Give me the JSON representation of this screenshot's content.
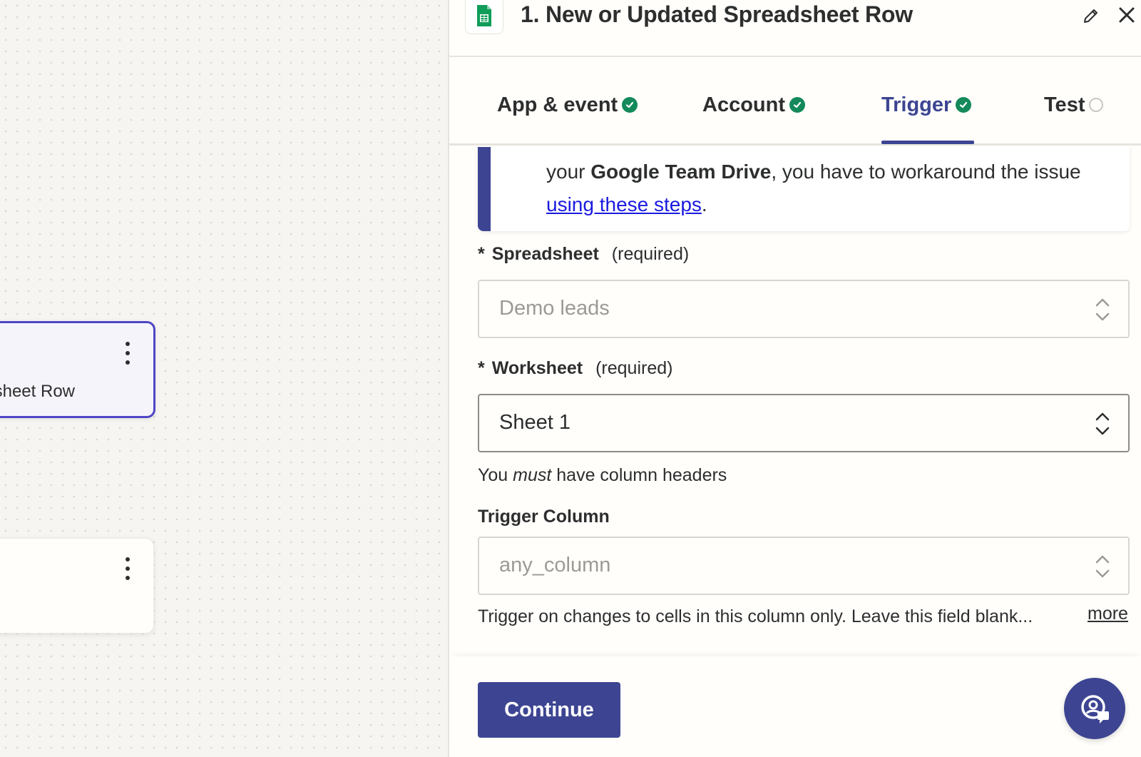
{
  "canvas": {
    "selected_node_label": "New or Updated Spreadsheet Row"
  },
  "panel": {
    "title": "1. New or Updated Spreadsheet Row",
    "tabs": [
      {
        "label": "App & event",
        "status": "complete"
      },
      {
        "label": "Account",
        "status": "complete"
      },
      {
        "label": "Trigger",
        "status": "complete",
        "active": true
      },
      {
        "label": "Test",
        "status": "pending"
      }
    ],
    "alert": {
      "text_1": "your ",
      "bold": "Google Team Drive",
      "text_2": ", you have to workaround the issue ",
      "link": "using these steps",
      "text_3": "."
    },
    "fields": {
      "spreadsheet": {
        "star": "*",
        "label": "Spreadsheet",
        "hint": "(required)",
        "value": "Demo leads"
      },
      "worksheet": {
        "star": "*",
        "label": "Worksheet",
        "hint": "(required)",
        "value": "Sheet 1",
        "help_before": "You ",
        "help_em": "must",
        "help_after": " have column headers"
      },
      "trigger_column": {
        "label": "Trigger Column",
        "value": "any_column",
        "help": "Trigger on changes to cells in this column only. Leave this field blank...",
        "more": "more"
      }
    },
    "continue_label": "Continue"
  },
  "colors": {
    "accent": "#3d4592",
    "check": "#14895a",
    "link": "#1a1ae0",
    "sheets_green": "#0f9d58"
  },
  "icons": [
    "google-sheets-icon",
    "pencil-icon",
    "close-icon",
    "check-circle-icon",
    "pending-circle-icon",
    "chevron-updown-icon",
    "kebab-menu-icon",
    "support-chat-icon"
  ]
}
